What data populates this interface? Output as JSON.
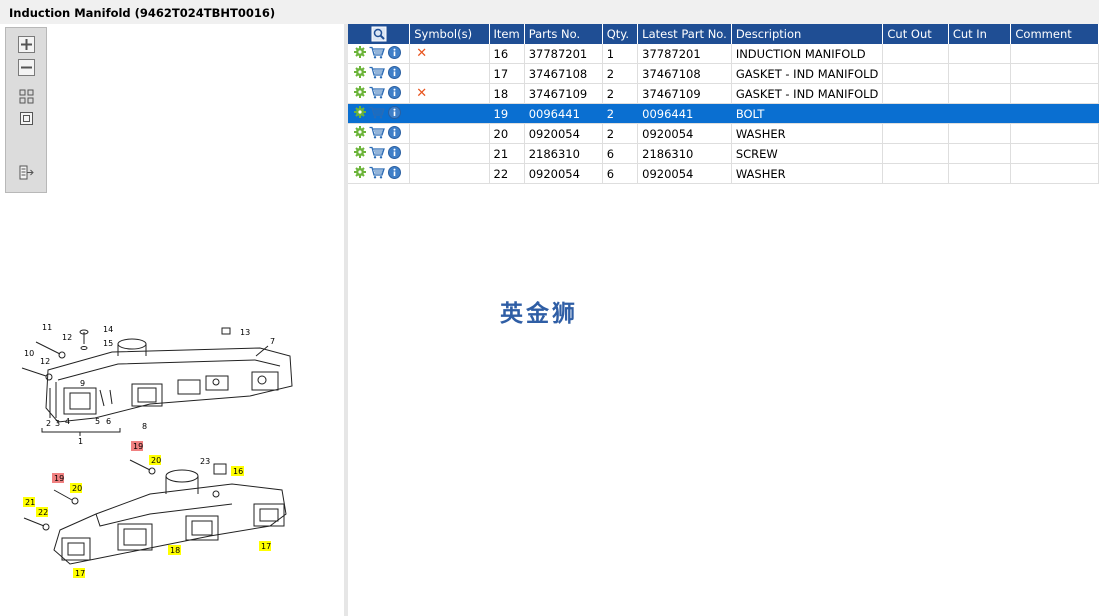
{
  "window": {
    "title": "Induction Manifold (9462T024TBHT0016)"
  },
  "toolbar": {
    "buttons": [
      {
        "name": "zoom-in",
        "icon": "plus-icon"
      },
      {
        "name": "zoom-out",
        "icon": "minus-icon"
      },
      {
        "name": "fit-view",
        "icon": "grid-fit-icon"
      },
      {
        "name": "actual-size",
        "icon": "square-icon"
      },
      {
        "name": "export",
        "icon": "export-icon"
      }
    ]
  },
  "table": {
    "columns": [
      "",
      "Symbol(s)",
      "Item",
      "Parts No.",
      "Qty.",
      "Latest Part No.",
      "Description",
      "Cut Out",
      "Cut In",
      "Comment"
    ],
    "rows": [
      {
        "symbol": "✕",
        "item": "16",
        "part_no": "37787201",
        "qty": "1",
        "latest": "37787201",
        "desc": "INDUCTION MANIFOLD",
        "cut_out": "",
        "cut_in": "",
        "comment": ""
      },
      {
        "symbol": "",
        "item": "17",
        "part_no": "37467108",
        "qty": "2",
        "latest": "37467108",
        "desc": "GASKET - IND MANIFOLD",
        "cut_out": "",
        "cut_in": "",
        "comment": ""
      },
      {
        "symbol": "✕",
        "item": "18",
        "part_no": "37467109",
        "qty": "2",
        "latest": "37467109",
        "desc": "GASKET - IND MANIFOLD",
        "cut_out": "",
        "cut_in": "",
        "comment": ""
      },
      {
        "symbol": "",
        "item": "19",
        "part_no": "0096441",
        "qty": "2",
        "latest": "0096441",
        "desc": "BOLT",
        "cut_out": "",
        "cut_in": "",
        "comment": ""
      },
      {
        "symbol": "",
        "item": "20",
        "part_no": "0920054",
        "qty": "2",
        "latest": "0920054",
        "desc": "WASHER",
        "cut_out": "",
        "cut_in": "",
        "comment": ""
      },
      {
        "symbol": "",
        "item": "21",
        "part_no": "2186310",
        "qty": "6",
        "latest": "2186310",
        "desc": "SCREW",
        "cut_out": "",
        "cut_in": "",
        "comment": ""
      },
      {
        "symbol": "",
        "item": "22",
        "part_no": "0920054",
        "qty": "6",
        "latest": "0920054",
        "desc": "WASHER",
        "cut_out": "",
        "cut_in": "",
        "comment": ""
      }
    ]
  },
  "watermark": "英金狮",
  "diagram": {
    "upper_labels": [
      "11",
      "12",
      "14",
      "15",
      "13",
      "7",
      "10",
      "12",
      "9",
      "2",
      "3",
      "4",
      "5",
      "6",
      "8",
      "1"
    ],
    "lower_labels": [
      "19",
      "20",
      "23",
      "16",
      "19",
      "20",
      "21",
      "22",
      "18",
      "17",
      "17"
    ]
  },
  "colors": {
    "header": "#1f4e94",
    "selected": "#0a6fd1",
    "highlight_yellow": "#ffff00",
    "highlight_red": "#f08080",
    "symbol_x": "#e8541e"
  }
}
